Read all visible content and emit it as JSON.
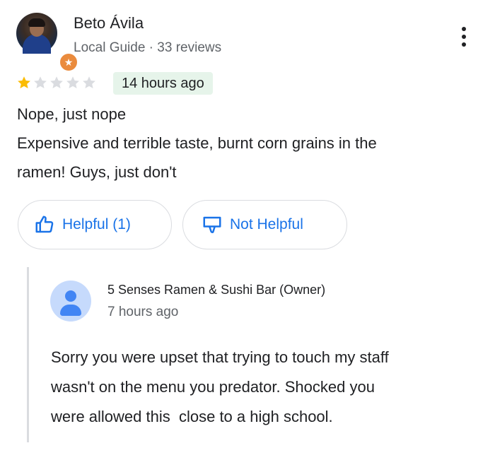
{
  "review": {
    "author": {
      "name": "Beto Ávila",
      "meta": "Local Guide · 33 reviews"
    },
    "rating": 1,
    "rating_max": 5,
    "time_ago": "14 hours ago",
    "text_lines": [
      "Nope, just nope",
      "Expensive and terrible taste, burnt corn grains in the",
      "ramen! Guys, just don't"
    ],
    "actions": {
      "helpful_label": "Helpful (1)",
      "not_helpful_label": "Not Helpful"
    }
  },
  "owner_reply": {
    "name": "5 Senses Ramen & Sushi Bar (Owner)",
    "time_ago": "7 hours ago",
    "text_lines": [
      "Sorry you were upset that trying to touch my staff",
      "wasn't on the menu you predator. Shocked you",
      "were allowed this  close to a high school."
    ]
  },
  "colors": {
    "accent": "#1a73e8",
    "star_filled": "#fbbc04",
    "star_empty": "#dadce0",
    "time_badge_bg": "#e6f4ea",
    "local_guide_badge": "#ea8b3d"
  },
  "icons": {
    "more": "more-vert-icon",
    "helpful": "thumb-up-icon",
    "not_helpful": "thumb-down-icon",
    "local_guide": "local-guide-star-icon"
  }
}
